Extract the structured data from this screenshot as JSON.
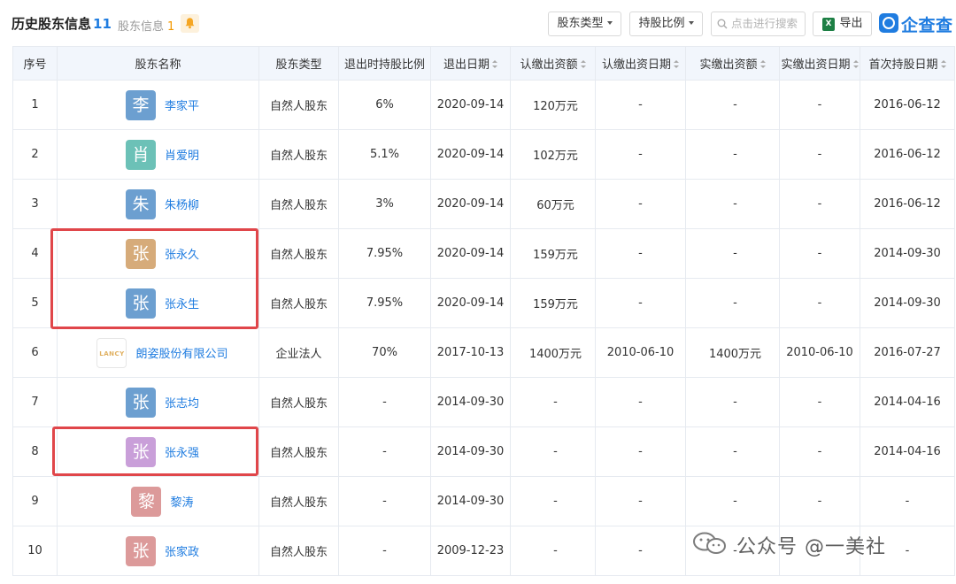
{
  "header": {
    "title": "历史股东信息",
    "title_count": "11",
    "subtab_label": "股东信息",
    "subtab_count": "1",
    "bell_icon": "bell-icon"
  },
  "toolbar": {
    "type_filter_label": "股东类型",
    "ratio_filter_label": "持股比例",
    "search_placeholder": "点击进行搜索",
    "export_label": "导出",
    "excel_icon_letter": "X",
    "logo_text": "企查查"
  },
  "table": {
    "columns": [
      "序号",
      "股东名称",
      "股东类型",
      "退出时持股比例",
      "退出日期",
      "认缴出资额",
      "认缴出资日期",
      "实缴出资额",
      "实缴出资日期",
      "首次持股日期"
    ],
    "rows": [
      {
        "no": "1",
        "avatar": "李",
        "avatar_color": "#6c9fd0",
        "name": "李家平",
        "type": "自然人股东",
        "exit_ratio": "6%",
        "exit_date": "2020-09-14",
        "sub_amount": "120万元",
        "sub_date": "-",
        "paid_amount": "-",
        "paid_date": "-",
        "first_date": "2016-06-12"
      },
      {
        "no": "2",
        "avatar": "肖",
        "avatar_color": "#6cc1b7",
        "name": "肖爱明",
        "type": "自然人股东",
        "exit_ratio": "5.1%",
        "exit_date": "2020-09-14",
        "sub_amount": "102万元",
        "sub_date": "-",
        "paid_amount": "-",
        "paid_date": "-",
        "first_date": "2016-06-12"
      },
      {
        "no": "3",
        "avatar": "朱",
        "avatar_color": "#6c9fd0",
        "name": "朱杨柳",
        "type": "自然人股东",
        "exit_ratio": "3%",
        "exit_date": "2020-09-14",
        "sub_amount": "60万元",
        "sub_date": "-",
        "paid_amount": "-",
        "paid_date": "-",
        "first_date": "2016-06-12"
      },
      {
        "no": "4",
        "avatar": "张",
        "avatar_color": "#d6ab7a",
        "name": "张永久",
        "type": "自然人股东",
        "exit_ratio": "7.95%",
        "exit_date": "2020-09-14",
        "sub_amount": "159万元",
        "sub_date": "-",
        "paid_amount": "-",
        "paid_date": "-",
        "first_date": "2014-09-30"
      },
      {
        "no": "5",
        "avatar": "张",
        "avatar_color": "#6c9fd0",
        "name": "张永生",
        "type": "自然人股东",
        "exit_ratio": "7.95%",
        "exit_date": "2020-09-14",
        "sub_amount": "159万元",
        "sub_date": "-",
        "paid_amount": "-",
        "paid_date": "-",
        "first_date": "2014-09-30"
      },
      {
        "no": "6",
        "avatar": "LANCY",
        "avatar_color": "#ffffff",
        "name": "朗姿股份有限公司",
        "type": "企业法人",
        "exit_ratio": "70%",
        "exit_date": "2017-10-13",
        "sub_amount": "1400万元",
        "sub_date": "2010-06-10",
        "paid_amount": "1400万元",
        "paid_date": "2010-06-10",
        "first_date": "2016-07-27"
      },
      {
        "no": "7",
        "avatar": "张",
        "avatar_color": "#6c9fd0",
        "name": "张志均",
        "type": "自然人股东",
        "exit_ratio": "-",
        "exit_date": "2014-09-30",
        "sub_amount": "-",
        "sub_date": "-",
        "paid_amount": "-",
        "paid_date": "-",
        "first_date": "2014-04-16"
      },
      {
        "no": "8",
        "avatar": "张",
        "avatar_color": "#c99fd9",
        "name": "张永强",
        "type": "自然人股东",
        "exit_ratio": "-",
        "exit_date": "2014-09-30",
        "sub_amount": "-",
        "sub_date": "-",
        "paid_amount": "-",
        "paid_date": "-",
        "first_date": "2014-04-16"
      },
      {
        "no": "9",
        "avatar": "黎",
        "avatar_color": "#dc9a9a",
        "name": "黎涛",
        "type": "自然人股东",
        "exit_ratio": "-",
        "exit_date": "2014-09-30",
        "sub_amount": "-",
        "sub_date": "-",
        "paid_amount": "-",
        "paid_date": "-",
        "first_date": "-"
      },
      {
        "no": "10",
        "avatar": "张",
        "avatar_color": "#dc9a9a",
        "name": "张家政",
        "type": "自然人股东",
        "exit_ratio": "-",
        "exit_date": "2009-12-23",
        "sub_amount": "-",
        "sub_date": "-",
        "paid_amount": "-",
        "paid_date": "-",
        "first_date": "-"
      }
    ]
  },
  "watermark": {
    "text": "公众号 @一美社",
    "icon": "wechat-icon"
  },
  "colors": {
    "accent": "#1f7ce0",
    "highlight": "#e0464a",
    "header_bg": "#f2f6fc",
    "subtab_count": "#f39800"
  }
}
